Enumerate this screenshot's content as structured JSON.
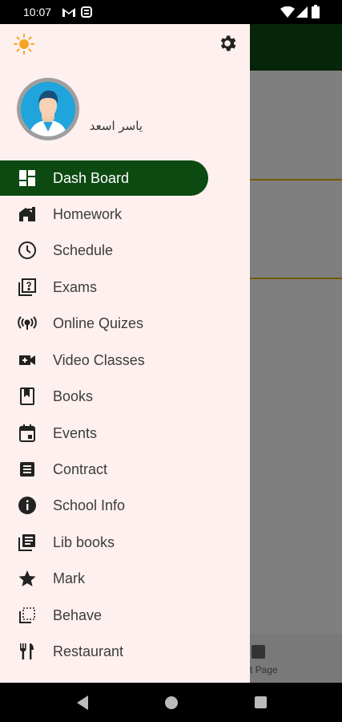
{
  "status_bar": {
    "time": "10:07",
    "icons": [
      "gmail-icon",
      "s-app-icon",
      "wifi-icon",
      "signal-icon",
      "battery-icon"
    ]
  },
  "background_app": {
    "toolbar_color": "#0d4a12",
    "bottom_nav_label": "t Page"
  },
  "drawer": {
    "header": {
      "theme_toggle_icon": "sun-icon",
      "settings_icon": "gear-icon",
      "user_name": "ياسر اسعد"
    },
    "items": [
      {
        "label": "Dash Board",
        "icon": "dashboard-icon",
        "active": true
      },
      {
        "label": "Homework",
        "icon": "homework-icon",
        "active": false
      },
      {
        "label": "Schedule",
        "icon": "clock-icon",
        "active": false
      },
      {
        "label": "Exams",
        "icon": "exam-icon",
        "active": false
      },
      {
        "label": "Online Quizes",
        "icon": "broadcast-icon",
        "active": false
      },
      {
        "label": "Video Classes",
        "icon": "video-add-icon",
        "active": false
      },
      {
        "label": "Books",
        "icon": "book-icon",
        "active": false
      },
      {
        "label": "Events",
        "icon": "calendar-icon",
        "active": false
      },
      {
        "label": "Contract",
        "icon": "document-icon",
        "active": false
      },
      {
        "label": "School Info",
        "icon": "info-icon",
        "active": false
      },
      {
        "label": "Lib books",
        "icon": "library-icon",
        "active": false
      },
      {
        "label": "Mark",
        "icon": "star-icon",
        "active": false
      },
      {
        "label": "Behave",
        "icon": "behave-icon",
        "active": false
      },
      {
        "label": "Restaurant",
        "icon": "restaurant-icon",
        "active": false
      }
    ]
  },
  "colors": {
    "accent_green": "#0d4a12",
    "drawer_bg": "#fdf0ef",
    "highlight_line": "#e0b400",
    "sun": "#f6a623"
  }
}
